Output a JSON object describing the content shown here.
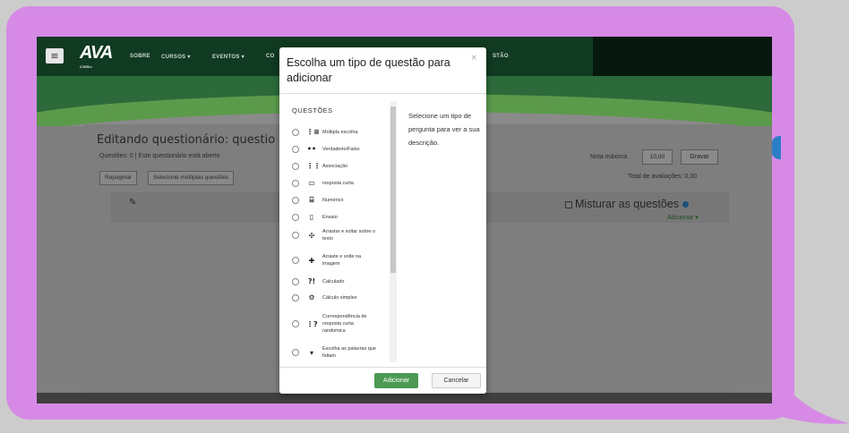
{
  "navbar": {
    "logo": "AVA",
    "logo_sub": "ICMBio",
    "items": [
      "SOBRE",
      "CURSOS ▾",
      "EVENTOS ▾",
      "CO",
      "STÃO"
    ]
  },
  "editor": {
    "title": "Editando questionário: questio",
    "subtitle": "Questões: 0 | Este questionário está aberto",
    "repaginar": "Repaginar",
    "select_multiple": "Selecione múltiplas questões",
    "nota_label": "Nota máxima",
    "nota_value": "10,00",
    "save": "Gravar",
    "total": "Total de avaliações: 0,00",
    "shuffle": "Misturar as questões",
    "add_link": "Adicionar ▾"
  },
  "modal": {
    "title": "Escolha um tipo de questão para adicionar",
    "close": "×",
    "section_heading": "QUESTÕES",
    "questions": [
      {
        "icon": "list-icon",
        "glyph": "⋮≡",
        "label": "Múltipla escolha"
      },
      {
        "icon": "dots-icon",
        "glyph": "••",
        "label": "Verdadeiro/Falso"
      },
      {
        "icon": "match-icon",
        "glyph": "⋮⋮",
        "label": "Associação"
      },
      {
        "icon": "short-answer-icon",
        "glyph": "▭",
        "label": "resposta curta"
      },
      {
        "icon": "numeric-icon",
        "glyph": "⌸",
        "label": "Numérico"
      },
      {
        "icon": "essay-icon",
        "glyph": "▯",
        "label": "Ensaio"
      },
      {
        "icon": "drag-text-icon",
        "glyph": "✣",
        "label": "Arrastar e soltar sobre o texto"
      },
      {
        "icon": "drag-image-icon",
        "glyph": "✚",
        "label": "Arraste e solte na imagem"
      },
      {
        "icon": "calculated-icon",
        "glyph": "?!",
        "label": "Calculado"
      },
      {
        "icon": "calc-simple-icon",
        "glyph": "⚙",
        "label": "Cálculo simples"
      },
      {
        "icon": "random-match-icon",
        "glyph": "⋮?",
        "label": "Correspondência de resposta curta randomica"
      },
      {
        "icon": "dropdown-icon",
        "glyph": "▾",
        "label": "Escolha as palavras que faltam"
      }
    ],
    "description": "Selecione um tipo de pergunta para ver a sua descrição.",
    "add_button": "Adicionar",
    "cancel_button": "Cancelar"
  }
}
